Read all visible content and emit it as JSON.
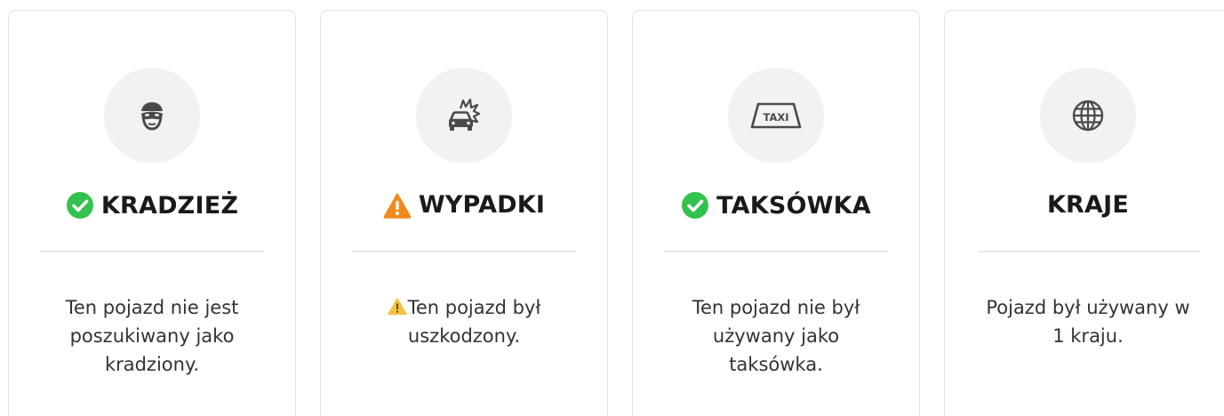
{
  "colors": {
    "check_green": "#33c24d",
    "warning_orange": "#f08a1c",
    "warning_yellow": "#f5c242",
    "icon_gray": "#4a4a4a",
    "circle_bg": "#f2f2f2"
  },
  "cards": [
    {
      "icon": "thief-mask-icon",
      "status": "ok",
      "title": "KRADZIEŻ",
      "description": "Ten pojazd nie jest poszukiwany jako kradziony."
    },
    {
      "icon": "car-crash-icon",
      "status": "warning",
      "title": "WYPADKI",
      "description": "Ten pojazd był uszkodzony."
    },
    {
      "icon": "taxi-sign-icon",
      "icon_text": "TAXI",
      "status": "ok",
      "title": "TAKSÓWKA",
      "description": "Ten pojazd nie był używany jako taksówka."
    },
    {
      "icon": "globe-icon",
      "status": "none",
      "title": "KRAJE",
      "description": "Pojazd był używany w 1 kraju."
    }
  ]
}
